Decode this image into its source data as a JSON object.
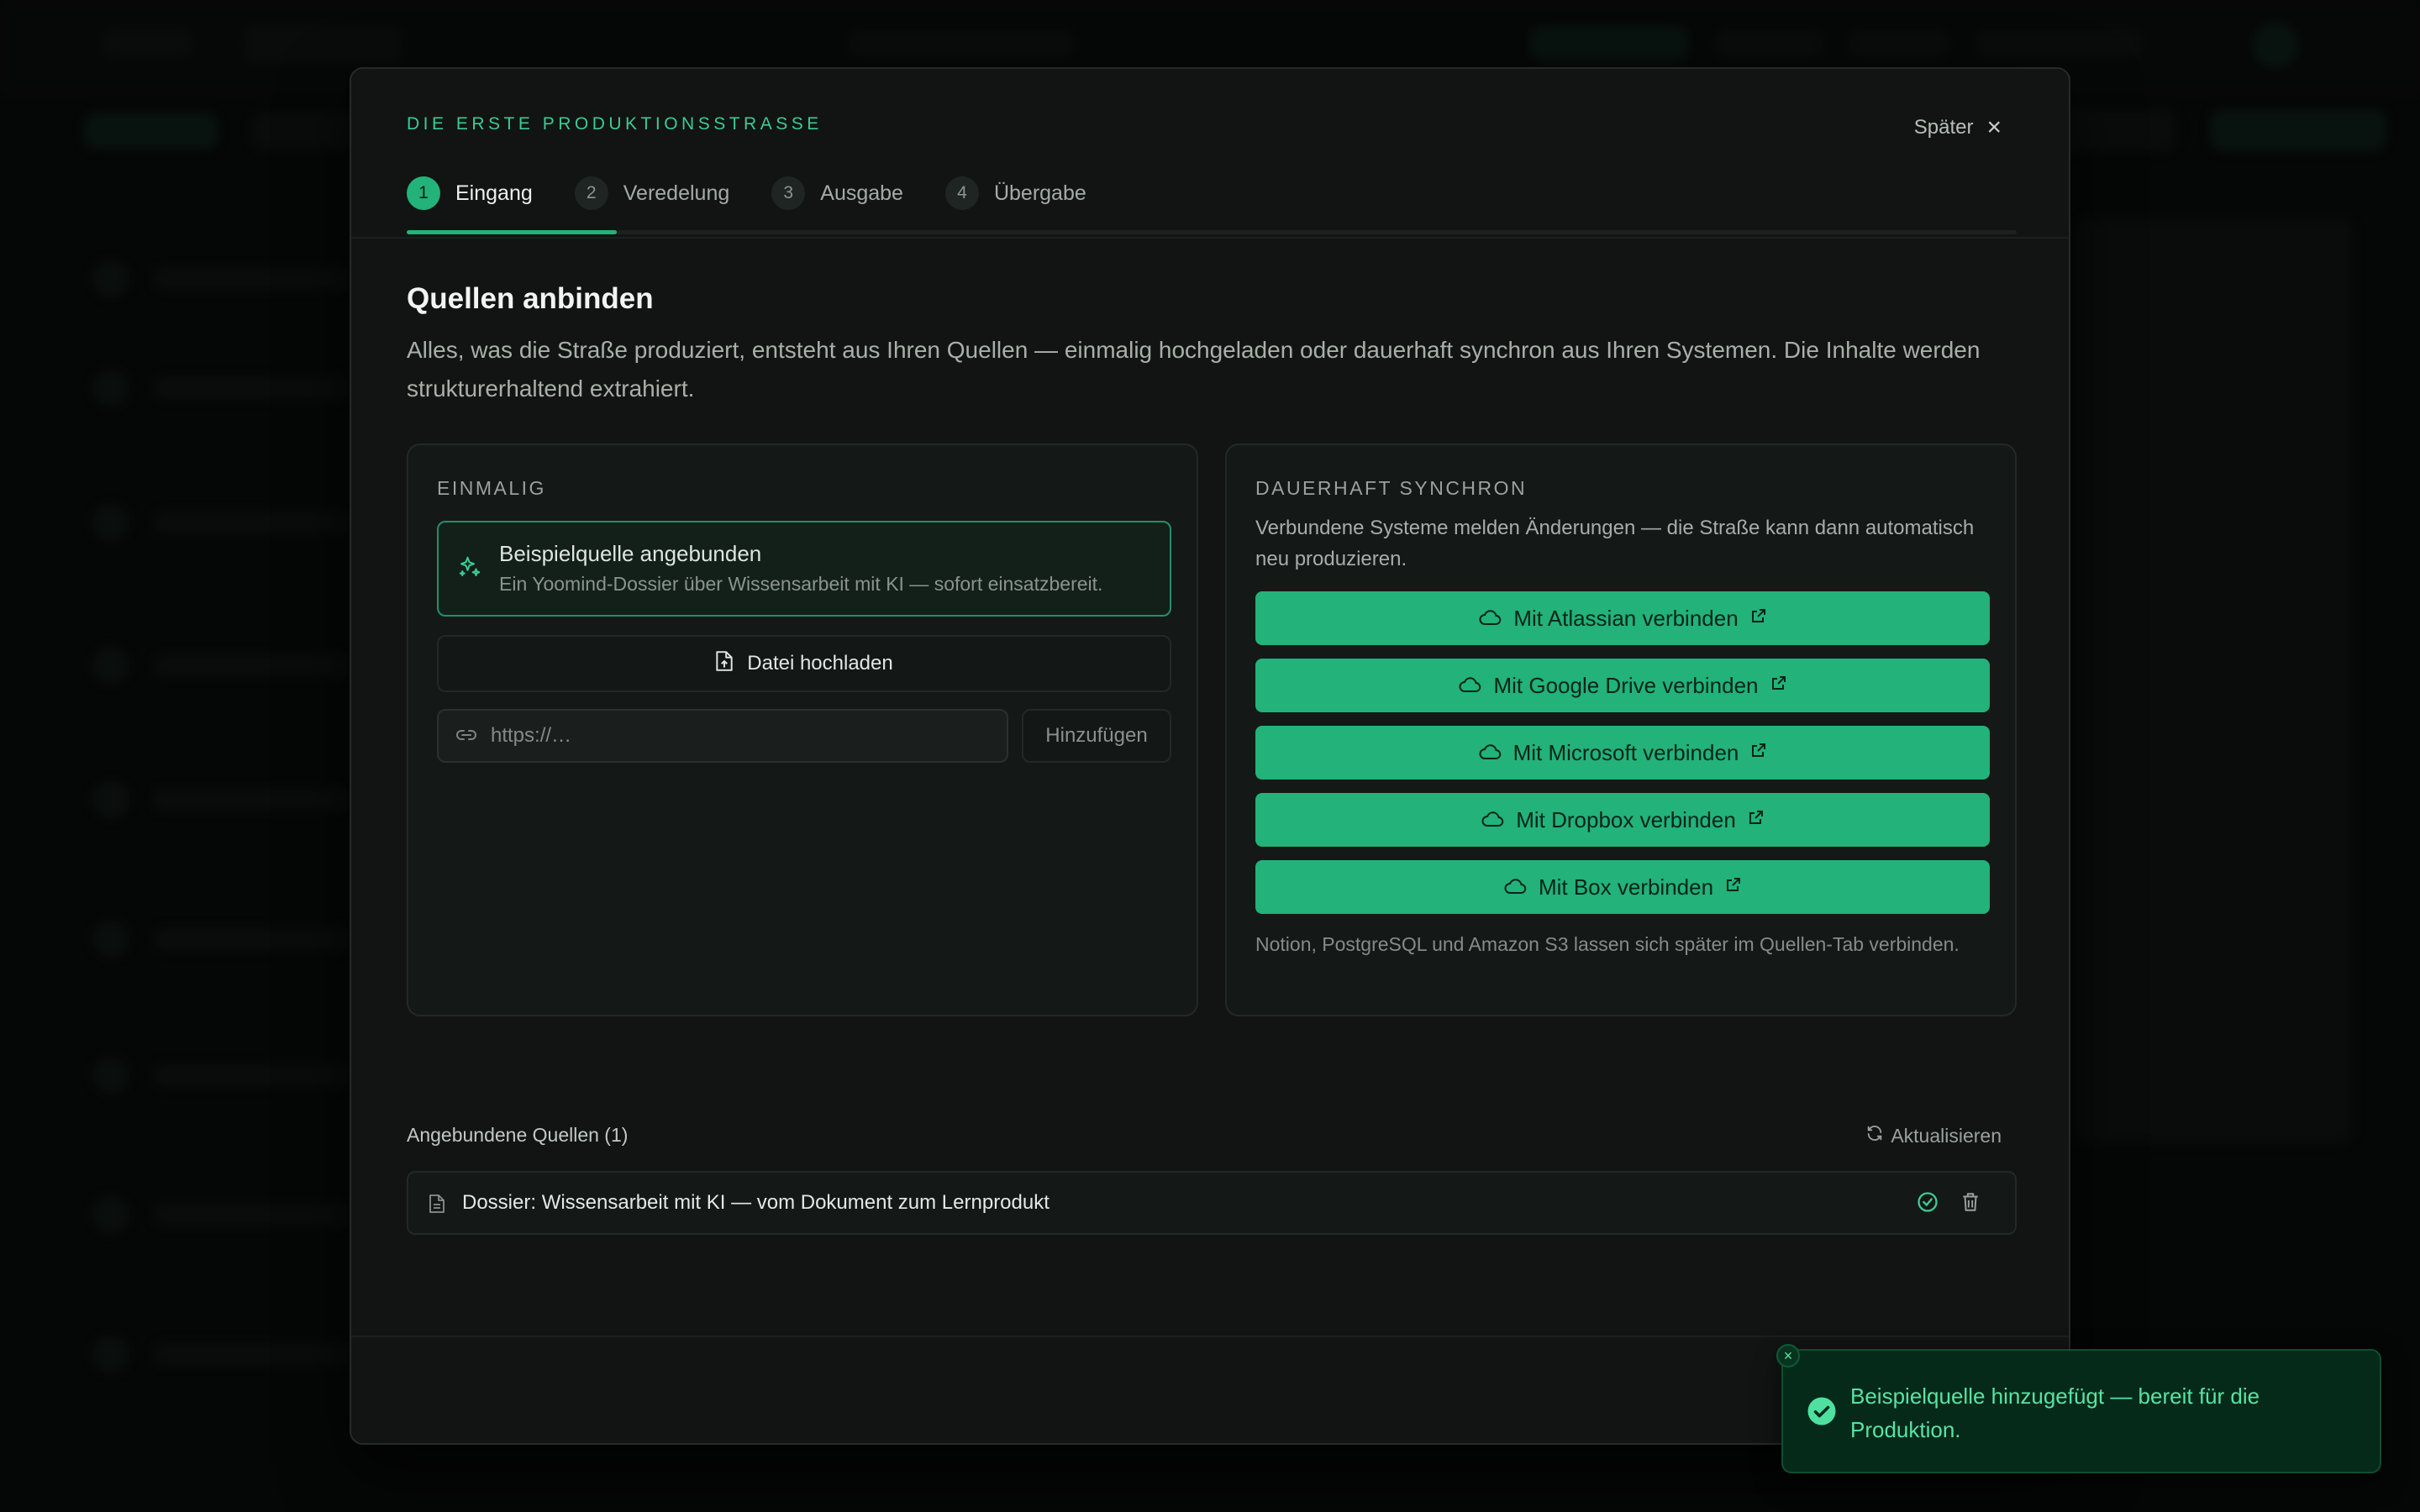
{
  "modal": {
    "eyebrow": "DIE ERSTE PRODUKTIONSSTRASSE",
    "later_label": "Später",
    "close_icon": "close-icon",
    "steps": [
      {
        "num": "1",
        "label": "Eingang"
      },
      {
        "num": "2",
        "label": "Veredelung"
      },
      {
        "num": "3",
        "label": "Ausgabe"
      },
      {
        "num": "4",
        "label": "Übergabe"
      }
    ],
    "active_step": 1,
    "title": "Quellen anbinden",
    "description": "Alles, was die Straße produziert, entsteht aus Ihren Quellen — einmalig hochgeladen oder dauerhaft synchron aus Ihren Systemen. Die Inhalte werden strukturerhaltend extrahiert."
  },
  "once": {
    "heading": "EINMALIG",
    "sample_title": "Beispielquelle angebunden",
    "sample_subtitle": "Ein Yoomind-Dossier über Wissensarbeit mit KI — sofort einsatzbereit.",
    "upload_label": "Datei hochladen",
    "url_placeholder": "https://…",
    "url_value": "",
    "add_label": "Hinzufügen"
  },
  "sync": {
    "heading": "DAUERHAFT SYNCHRON",
    "description": "Verbundene Systeme melden Änderungen — die Straße kann dann automatisch neu produzieren.",
    "connectors": [
      {
        "label": "Mit Atlassian verbinden"
      },
      {
        "label": "Mit Google Drive verbinden"
      },
      {
        "label": "Mit Microsoft verbinden"
      },
      {
        "label": "Mit Dropbox verbinden"
      },
      {
        "label": "Mit Box verbinden"
      }
    ],
    "note": "Notion, PostgreSQL und Amazon S3 lassen sich später im Quellen-Tab verbinden."
  },
  "sources": {
    "heading": "Angebundene Quellen (1)",
    "refresh_label": "Aktualisieren",
    "items": [
      {
        "name": "Dossier: Wissensarbeit mit KI — vom Dokument zum Lernprodukt"
      }
    ]
  },
  "toast": {
    "message": "Beispielquelle hinzugefügt — bereit für die Produktion."
  },
  "colors": {
    "accent": "#22b27a",
    "accent_text": "#3ccb93",
    "toast_bg": "#062a19"
  }
}
